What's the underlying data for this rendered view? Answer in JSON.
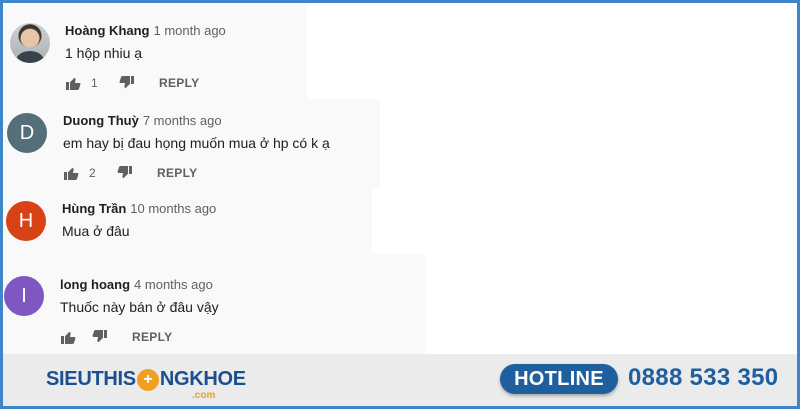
{
  "comments": [
    {
      "author": "Hoàng Khang",
      "time": "1 month ago",
      "text": "1 hộp nhiu ạ",
      "likes": "1",
      "reply": "REPLY",
      "avatar_letter": "",
      "avatar_color": ""
    },
    {
      "author": "Duong Thuỳ",
      "time": "7 months ago",
      "text": "em hay bị đau họng muốn mua ở hp có k ạ",
      "likes": "2",
      "reply": "REPLY",
      "avatar_letter": "D",
      "avatar_color": "#546e7a"
    },
    {
      "author": "Hùng Trần",
      "time": "10 months ago",
      "text": "Mua ở đâu",
      "likes": "",
      "reply": "",
      "avatar_letter": "H",
      "avatar_color": "#d84315"
    },
    {
      "author": "long hoang",
      "time": "4 months ago",
      "text": "Thuốc này bán ở đâu vậy",
      "likes": "",
      "reply": "REPLY",
      "avatar_letter": "I",
      "avatar_color": "#7e57c2"
    }
  ],
  "footer": {
    "logo_part1": "SIEUTHIS",
    "logo_cross": "+",
    "logo_part2": "NGKHOE",
    "logo_domain": ".com",
    "hotline_label": "HOTLINE",
    "hotline_number": "0888 533 350"
  },
  "colors": {
    "frame": "#3e86c8",
    "brand_blue": "#1f5f9e",
    "brand_orange": "#f0a020"
  }
}
